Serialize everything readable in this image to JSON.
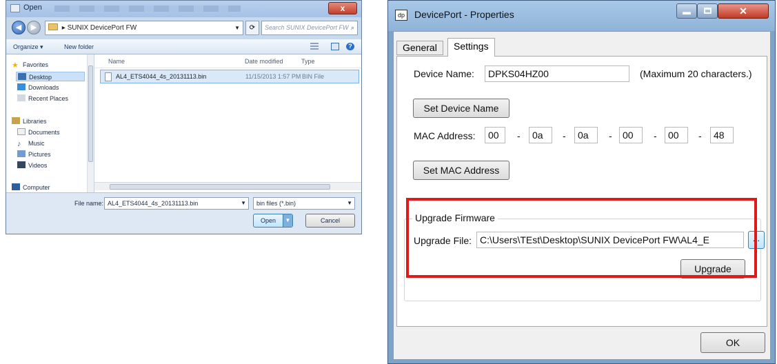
{
  "open_dialog": {
    "title": "Open",
    "close_label": "x",
    "address_path": "SUNIX DevicePort FW",
    "search_placeholder": "Search SUNIX DevicePort FW",
    "toolbar": {
      "organize": "Organize ▾",
      "new_folder": "New folder"
    },
    "nav": {
      "favorites": "Favorites",
      "desktop": "Desktop",
      "downloads": "Downloads",
      "recent_places": "Recent Places",
      "libraries": "Libraries",
      "documents": "Documents",
      "music": "Music",
      "pictures": "Pictures",
      "videos": "Videos",
      "computer": "Computer"
    },
    "columns": {
      "name": "Name",
      "date_modified": "Date modified",
      "type": "Type"
    },
    "files": [
      {
        "name": "AL4_ETS4044_4s_20131113.bin",
        "date_modified": "11/15/2013 1:57 PM",
        "type": "BIN File"
      }
    ],
    "file_name_label": "File name:",
    "file_name_value": "AL4_ETS4044_4s_20131113.bin",
    "file_type_value": "bin files (*.bin)",
    "open_button": "Open",
    "cancel_button": "Cancel"
  },
  "properties_dialog": {
    "icon_text": "dp",
    "title": "DevicePort - Properties",
    "tabs": {
      "general": "General",
      "settings": "Settings"
    },
    "device_name_label": "Device Name:",
    "device_name_value": "DPKS04HZ00",
    "device_name_hint": "(Maximum  20 characters.)",
    "set_device_name_button": "Set Device Name",
    "mac_address_label": "MAC Address:",
    "mac_octets": [
      "00",
      "0a",
      "0a",
      "00",
      "00",
      "48"
    ],
    "mac_separator": "-",
    "set_mac_address_button": "Set MAC Address",
    "upgrade_group_title": "Upgrade Firmware",
    "upgrade_file_label": "Upgrade File:",
    "upgrade_file_value": "C:\\Users\\TEst\\Desktop\\SUNIX DevicePort FW\\AL4_E",
    "browse_button": "...",
    "upgrade_button": "Upgrade",
    "ok_button": "OK",
    "highlight_color": "#e01919"
  }
}
